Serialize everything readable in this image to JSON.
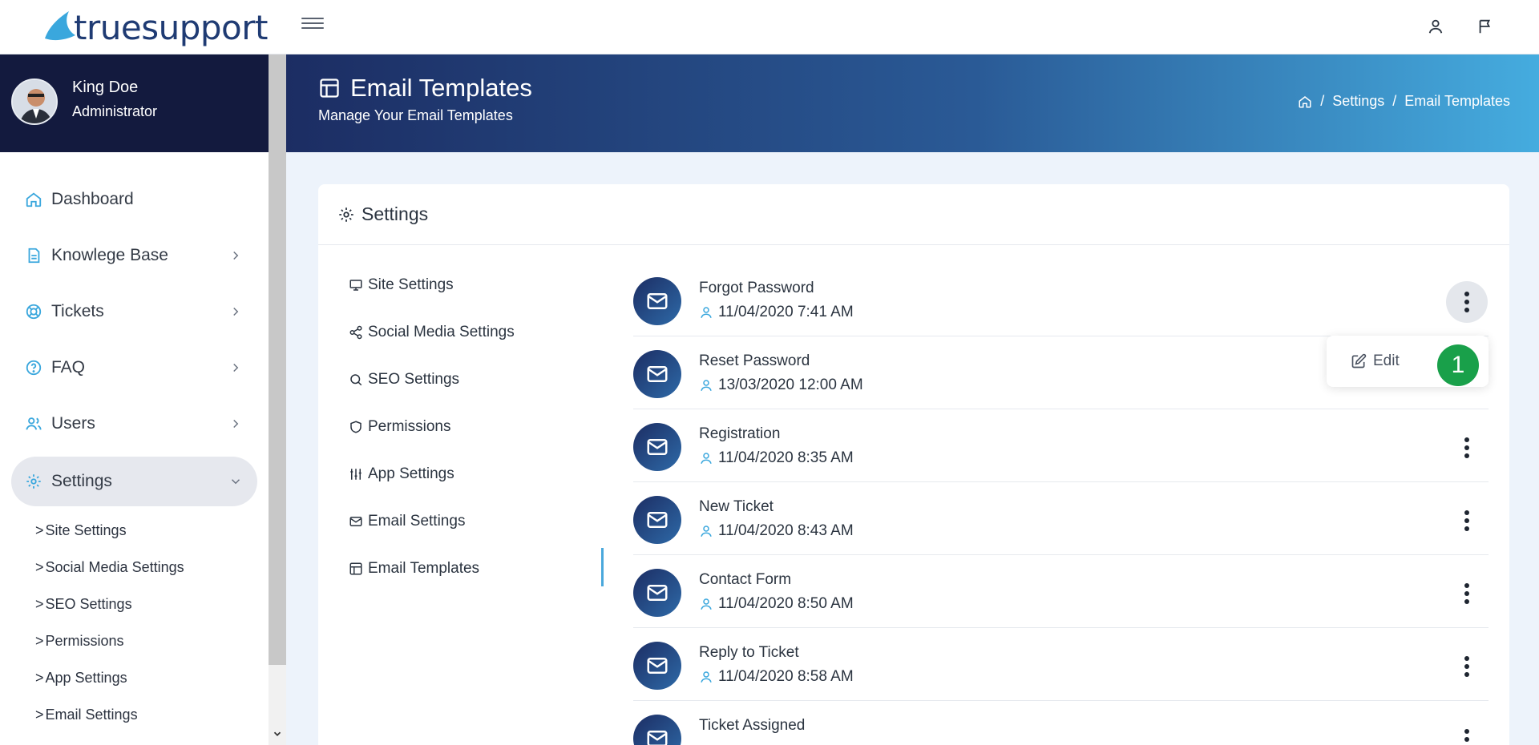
{
  "brand": {
    "name": "truesupport"
  },
  "user": {
    "name": "King Doe",
    "role": "Administrator"
  },
  "nav": {
    "items": [
      {
        "label": "Dashboard",
        "icon": "home-icon"
      },
      {
        "label": "Knowlege Base",
        "icon": "document-icon"
      },
      {
        "label": "Tickets",
        "icon": "lifebuoy-icon"
      },
      {
        "label": "FAQ",
        "icon": "help-circle-icon"
      },
      {
        "label": "Users",
        "icon": "users-icon"
      },
      {
        "label": "Settings",
        "icon": "gear-icon"
      }
    ],
    "sub_items": [
      "Site Settings",
      "Social Media Settings",
      "SEO Settings",
      "Permissions",
      "App Settings",
      "Email Settings"
    ]
  },
  "header": {
    "title": "Email Templates",
    "subtitle": "Manage Your Email Templates",
    "breadcrumb": [
      "Settings",
      "Email Templates"
    ],
    "separator": "/"
  },
  "card": {
    "title": "Settings"
  },
  "settings_menu": [
    {
      "label": "Site Settings",
      "icon": "monitor-icon"
    },
    {
      "label": "Social Media Settings",
      "icon": "share-icon"
    },
    {
      "label": "SEO Settings",
      "icon": "search-icon"
    },
    {
      "label": "Permissions",
      "icon": "shield-icon"
    },
    {
      "label": "App Settings",
      "icon": "sliders-icon"
    },
    {
      "label": "Email Settings",
      "icon": "mail-icon"
    },
    {
      "label": "Email Templates",
      "icon": "layout-icon"
    }
  ],
  "templates": [
    {
      "name": "Forgot Password",
      "date": "11/04/2020 7:41 AM"
    },
    {
      "name": "Reset Password",
      "date": "13/03/2020 12:00 AM"
    },
    {
      "name": "Registration",
      "date": "11/04/2020 8:35 AM"
    },
    {
      "name": "New Ticket",
      "date": "11/04/2020 8:43 AM"
    },
    {
      "name": "Contact Form",
      "date": "11/04/2020 8:50 AM"
    },
    {
      "name": "Reply to Ticket",
      "date": "11/04/2020 8:58 AM"
    },
    {
      "name": "Ticket Assigned",
      "date": ""
    }
  ],
  "dropdown": {
    "edit_label": "Edit"
  },
  "annotation": {
    "badge": "1"
  },
  "colors": {
    "accent": "#4aa8dc",
    "dark": "#131a3e",
    "badge": "#19a04a"
  }
}
